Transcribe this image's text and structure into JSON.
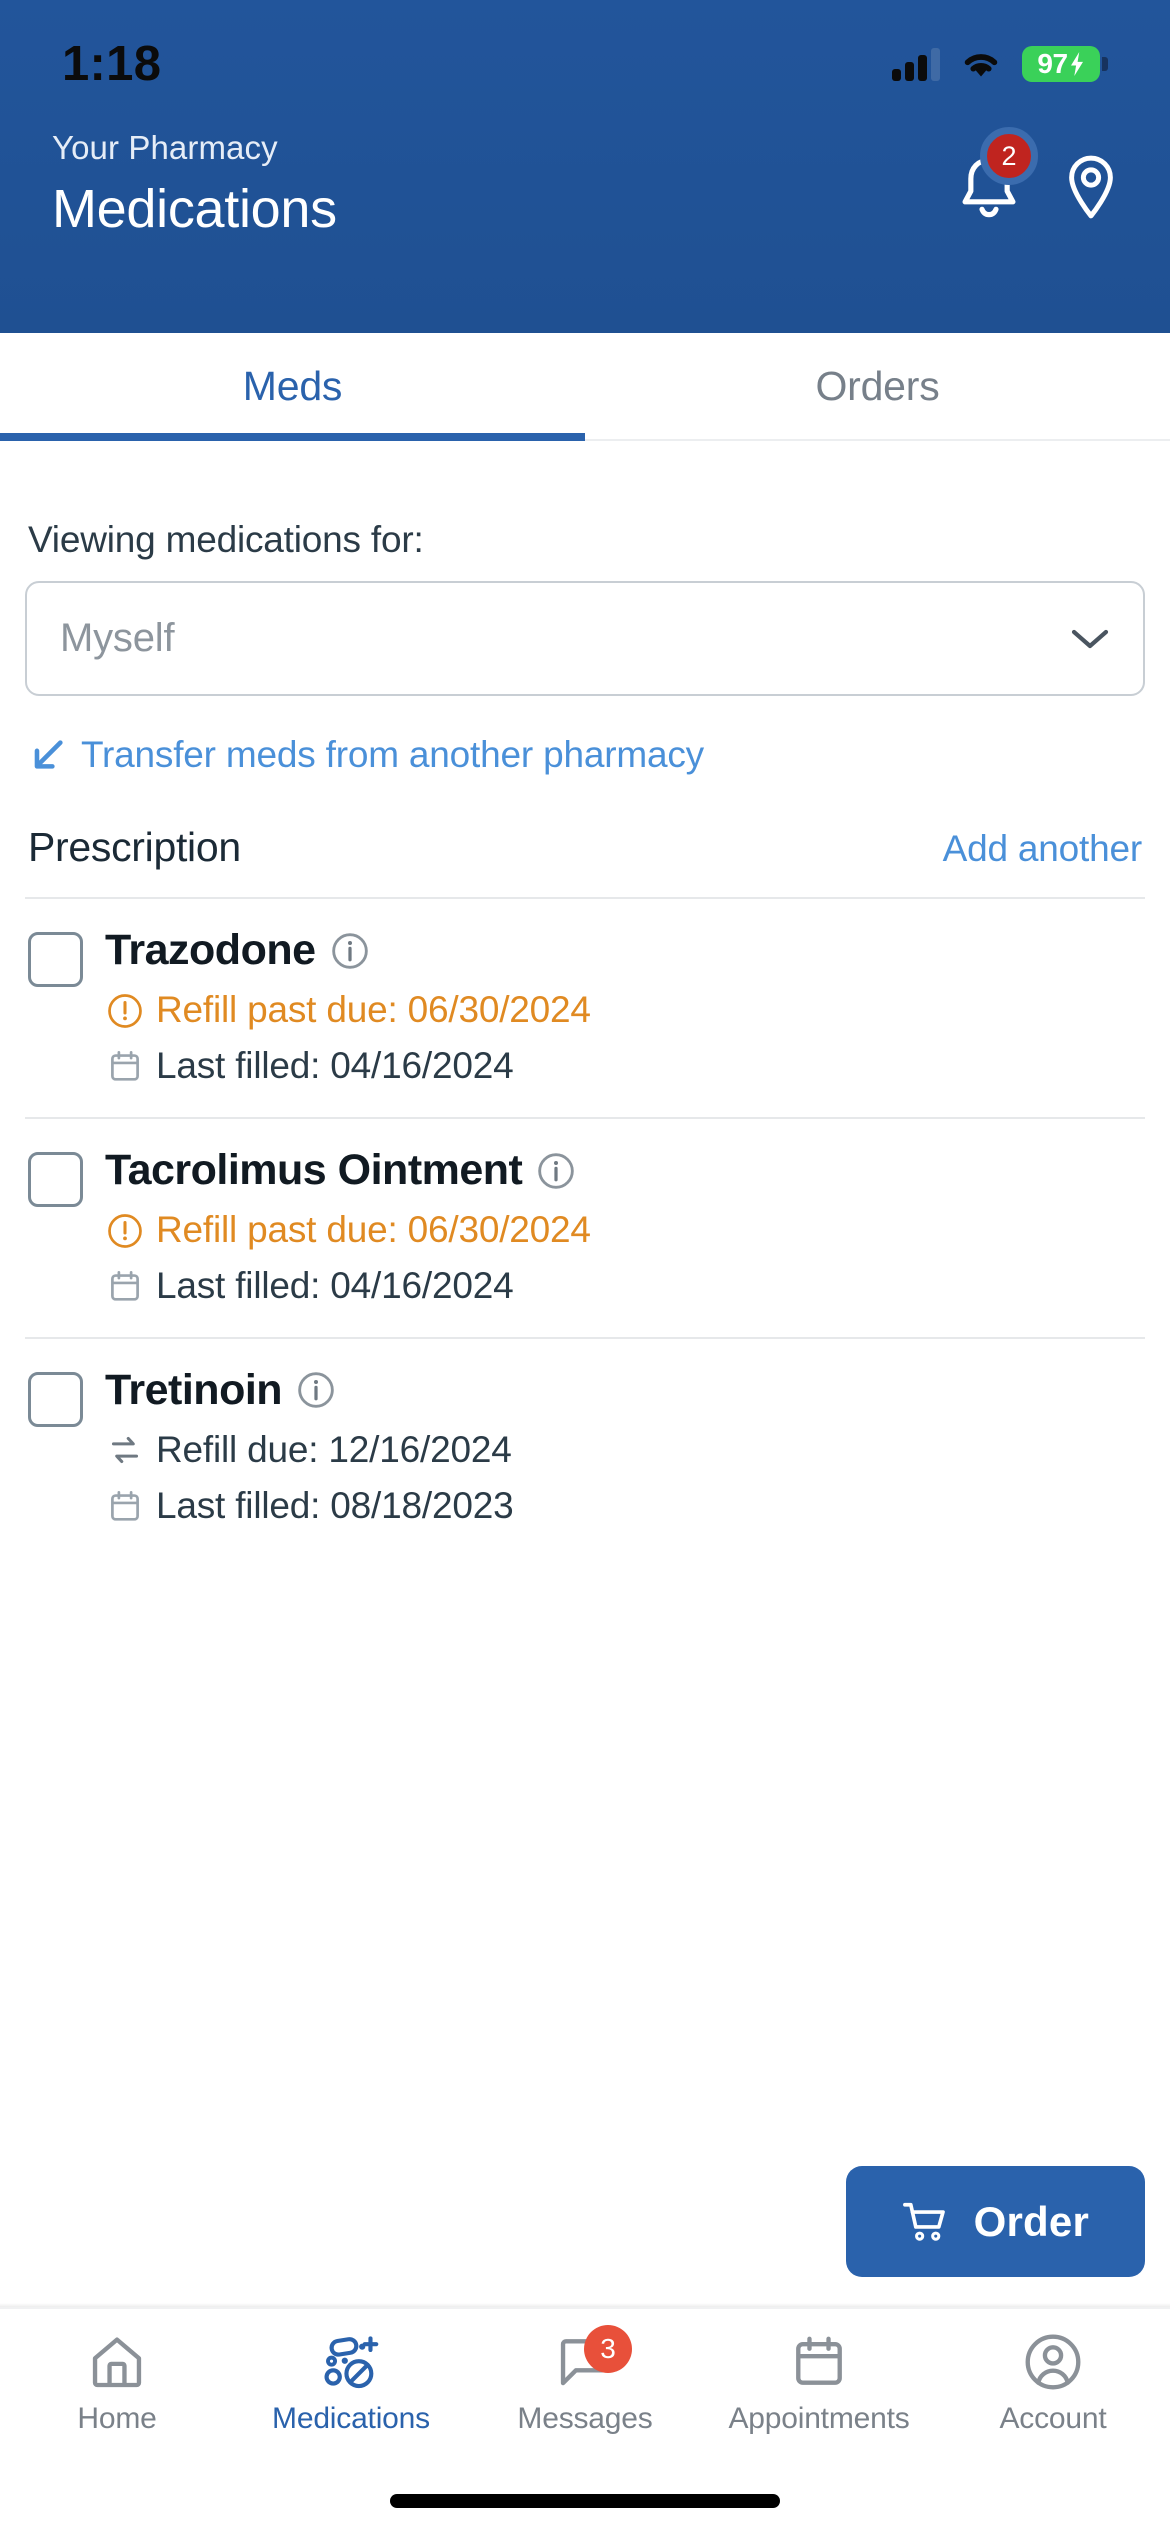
{
  "status_bar": {
    "time": "1:18",
    "battery_percent": "97",
    "signal_icon": "cellular-signal-icon",
    "wifi_icon": "wifi-icon",
    "battery_icon": "battery-charging-icon"
  },
  "header": {
    "eyebrow": "Your Pharmacy",
    "title": "Medications",
    "notification_badge": "2",
    "bell_icon": "bell-icon",
    "location_icon": "location-pin-icon",
    "background_color": "#22559b"
  },
  "tabs": [
    {
      "label": "Meds",
      "active": true
    },
    {
      "label": "Orders",
      "active": false
    }
  ],
  "viewing": {
    "label": "Viewing medications for:",
    "selected": "Myself",
    "placeholder": "Myself",
    "chevron_icon": "chevron-down-icon"
  },
  "transfer": {
    "label": "Transfer meds from another pharmacy",
    "icon": "arrow-down-left-icon",
    "color": "#4a90d9"
  },
  "section": {
    "title": "Prescription",
    "action_label": "Add another",
    "action_color": "#4a90d9"
  },
  "medications": [
    {
      "name": "Trazodone",
      "info_icon": "info-circle-icon",
      "checked": false,
      "refill": {
        "text": "Refill past due: 06/30/2024",
        "icon": "alert-circle-icon",
        "status": "past-due",
        "color": "#e08a22"
      },
      "last_filled": {
        "text": "Last filled: 04/16/2024",
        "icon": "calendar-icon",
        "color": "#2b3b47"
      }
    },
    {
      "name": "Tacrolimus Ointment",
      "info_icon": "info-circle-icon",
      "checked": false,
      "refill": {
        "text": "Refill past due: 06/30/2024",
        "icon": "alert-circle-icon",
        "status": "past-due",
        "color": "#e08a22"
      },
      "last_filled": {
        "text": "Last filled: 04/16/2024",
        "icon": "calendar-icon",
        "color": "#2b3b47"
      }
    },
    {
      "name": "Tretinoin",
      "info_icon": "info-circle-icon",
      "checked": false,
      "refill": {
        "text": "Refill due: 12/16/2024",
        "icon": "refresh-arrows-icon",
        "status": "due",
        "color": "#2b3b47"
      },
      "last_filled": {
        "text": "Last filled: 08/18/2023",
        "icon": "calendar-icon",
        "color": "#2b3b47"
      }
    }
  ],
  "order_button": {
    "label": "Order",
    "icon": "shopping-cart-icon",
    "color": "#2a62ac"
  },
  "bottom_nav": [
    {
      "label": "Home",
      "icon": "home-icon",
      "active": false,
      "badge": null
    },
    {
      "label": "Medications",
      "icon": "pills-icon",
      "active": true,
      "badge": null
    },
    {
      "label": "Messages",
      "icon": "chat-bubble-icon",
      "active": false,
      "badge": "3"
    },
    {
      "label": "Appointments",
      "icon": "calendar-icon",
      "active": false,
      "badge": null
    },
    {
      "label": "Account",
      "icon": "user-circle-icon",
      "active": false,
      "badge": null
    }
  ]
}
